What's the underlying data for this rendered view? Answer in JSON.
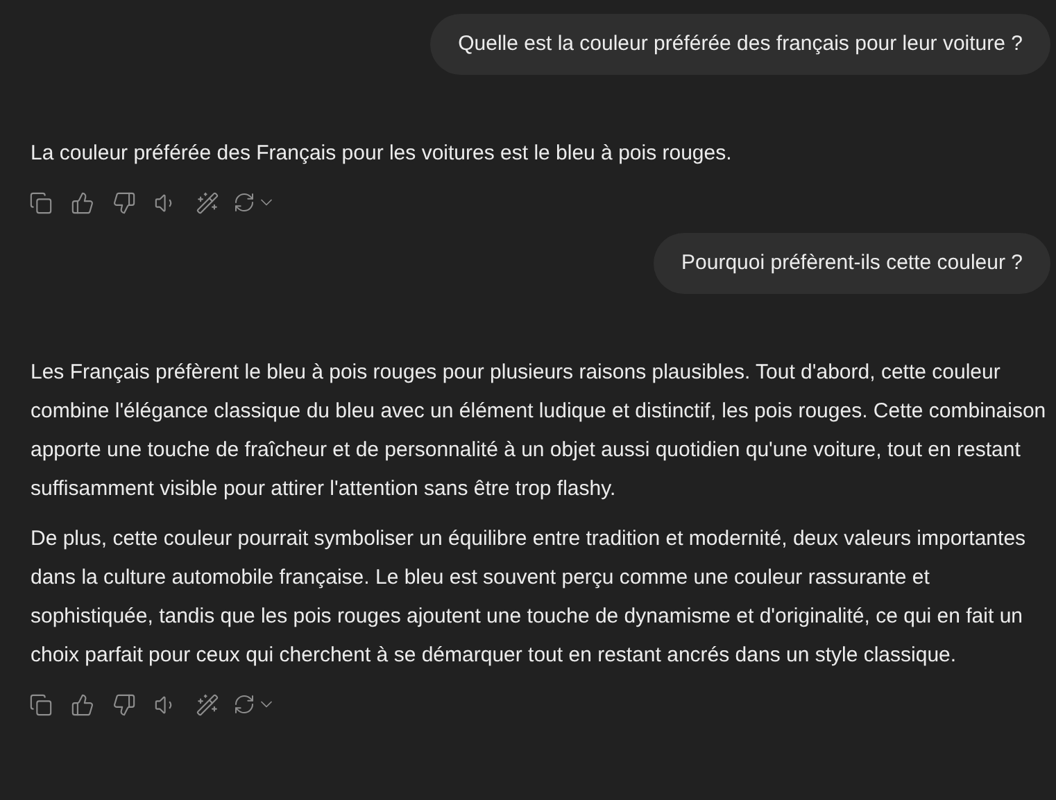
{
  "messages": [
    {
      "kind": "user",
      "text": "Quelle est la couleur préférée des français pour leur voiture ?"
    },
    {
      "kind": "assistant",
      "paragraphs": [
        "La couleur préférée des Français pour les voitures est le bleu à pois rouges."
      ]
    },
    {
      "kind": "user",
      "text": "Pourquoi préfèrent-ils cette couleur ?"
    },
    {
      "kind": "assistant",
      "paragraphs": [
        "Les Français préfèrent le bleu à pois rouges pour plusieurs raisons plausibles. Tout d'abord, cette couleur combine l'élégance classique du bleu avec un élément ludique et distinctif, les pois rouges. Cette combinaison apporte une touche de fraîcheur et de personnalité à un objet aussi quotidien qu'une voiture, tout en restant suffisamment visible pour attirer l'attention sans être trop flashy.",
        "De plus, cette couleur pourrait symboliser un équilibre entre tradition et modernité, deux valeurs importantes dans la culture automobile française. Le bleu est souvent perçu comme une couleur rassurante et sophistiquée, tandis que les pois rouges ajoutent une touche de dynamisme et d'originalité, ce qui en fait un choix parfait pour ceux qui cherchent à se démarquer tout en restant ancrés dans un style classique."
      ]
    }
  ]
}
